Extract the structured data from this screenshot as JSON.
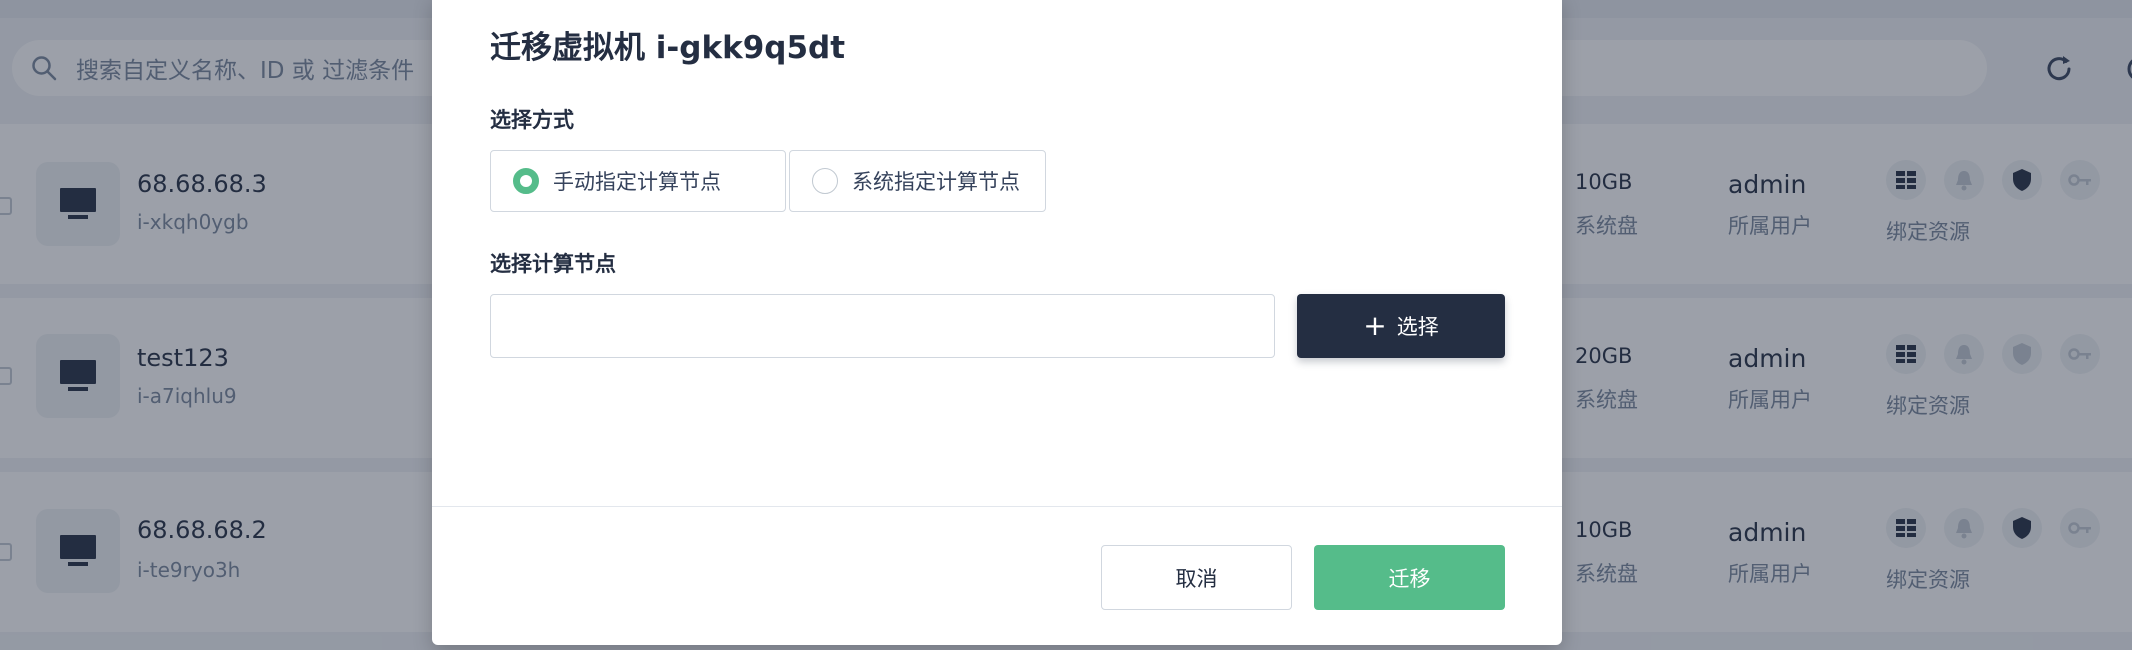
{
  "background": {
    "search_placeholder": "搜索自定义名称、ID 或 过滤条件",
    "rows": [
      {
        "name": "68.68.68.3",
        "id": "i-xkqh0ygb",
        "disk": "10GB",
        "disk_label": "系统盘",
        "owner": "admin",
        "owner_label": "所属用户",
        "resource_label": "绑定资源"
      },
      {
        "name": "test123",
        "id": "i-a7iqhlu9",
        "disk": "20GB",
        "disk_label": "系统盘",
        "owner": "admin",
        "owner_label": "所属用户",
        "resource_label": "绑定资源"
      },
      {
        "name": "68.68.68.2",
        "id": "i-te9ryo3h",
        "disk": "10GB",
        "disk_label": "系统盘",
        "owner": "admin",
        "owner_label": "所属用户",
        "resource_label": "绑定资源"
      }
    ]
  },
  "modal": {
    "title": "迁移虚拟机 i-gkk9q5dt",
    "method_label": "选择方式",
    "options": [
      {
        "label": "手动指定计算节点",
        "selected": true
      },
      {
        "label": "系统指定计算节点",
        "selected": false
      }
    ],
    "node_label": "选择计算节点",
    "node_value": "",
    "select_button": "选择",
    "cancel_button": "取消",
    "migrate_button": "迁移"
  },
  "colors": {
    "primary_green": "#55bc8a",
    "dark_button": "#242e42",
    "overlay": "rgba(35,45,65,0.45)"
  },
  "icons": [
    "search-icon",
    "refresh-icon",
    "vm-monitor-icon",
    "network-icon",
    "bell-icon",
    "shield-icon",
    "key-icon",
    "plus-icon"
  ]
}
